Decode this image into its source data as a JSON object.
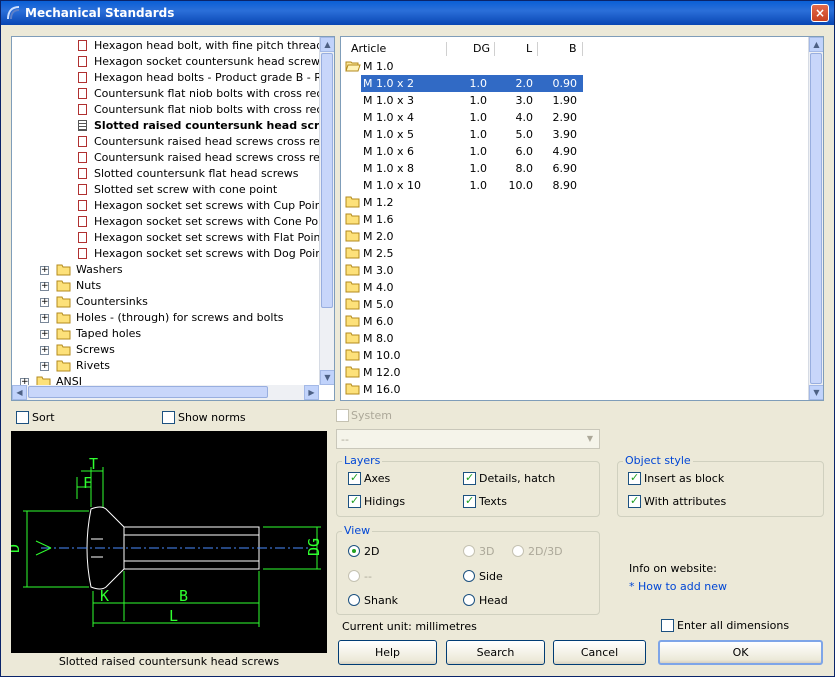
{
  "window": {
    "title": "Mechanical Standards",
    "close_label": "×"
  },
  "tree": {
    "items": [
      "Hexagon head bolt, with fine pitch thread",
      "Hexagon socket countersunk head screws",
      "Hexagon head bolts - Product grade B - Reduc",
      "Countersunk flat niob bolts with cross recess H",
      "Countersunk flat niob bolts with cross recess Z",
      "Slotted raised countersunk head screws",
      "Countersunk raised head screws cross recess-",
      "Countersunk raised head screws cross recess-",
      "Slotted countersunk flat head screws",
      "Slotted set screw with cone point",
      "Hexagon socket set screws with Cup Point",
      "Hexagon socket set screws with Cone Point",
      "Hexagon socket set screws with Flat Point",
      "Hexagon socket set screws with Dog Point"
    ],
    "selected_index": 5,
    "groups": [
      "Washers",
      "Nuts",
      "Countersinks",
      "Holes - (through) for screws and bolts",
      "Taped holes",
      "Screws",
      "Rivets"
    ],
    "root": "ANSI"
  },
  "articles": {
    "columns": {
      "article": "Article",
      "dg": "DG",
      "l": "L",
      "b": "B"
    },
    "open_folder": "M 1.0",
    "rows": [
      {
        "article": "M 1.0 x 2",
        "dg": "1.0",
        "l": "2.0",
        "b": "0.90"
      },
      {
        "article": "M 1.0 x 3",
        "dg": "1.0",
        "l": "3.0",
        "b": "1.90"
      },
      {
        "article": "M 1.0 x 4",
        "dg": "1.0",
        "l": "4.0",
        "b": "2.90"
      },
      {
        "article": "M 1.0 x 5",
        "dg": "1.0",
        "l": "5.0",
        "b": "3.90"
      },
      {
        "article": "M 1.0 x 6",
        "dg": "1.0",
        "l": "6.0",
        "b": "4.90"
      },
      {
        "article": "M 1.0 x 8",
        "dg": "1.0",
        "l": "8.0",
        "b": "6.90"
      },
      {
        "article": "M 1.0 x 10",
        "dg": "1.0",
        "l": "10.0",
        "b": "8.90"
      }
    ],
    "selected_row": 0,
    "folders": [
      "M 1.2",
      "M 1.6",
      "M 2.0",
      "M 2.5",
      "M 3.0",
      "M 4.0",
      "M 5.0",
      "M 6.0",
      "M 8.0",
      "M 10.0",
      "M 12.0",
      "M 16.0"
    ]
  },
  "options": {
    "sort": "Sort",
    "show_norms": "Show norms",
    "system": "System",
    "system_value": "--",
    "layers_title": "Layers",
    "axes": "Axes",
    "details_hatch": "Details, hatch",
    "hidings": "Hidings",
    "texts": "Texts",
    "object_style_title": "Object style",
    "insert_as_block": "Insert as block",
    "with_attributes": "With attributes",
    "view_title": "View",
    "view_2d": "2D",
    "view_3d": "3D",
    "view_2d3d": "2D/3D",
    "view_none": "--",
    "view_side": "Side",
    "view_shank": "Shank",
    "view_head": "Head",
    "info_label": "Info on website:",
    "info_link": "* How to add new",
    "current_unit": "Current unit: millimetres",
    "enter_all_dims": "Enter all dimensions"
  },
  "preview": {
    "caption": "Slotted raised countersunk head screws",
    "dim_labels": {
      "t": "T",
      "f": "F",
      "d": "D",
      "dg": "DG",
      "k": "K",
      "b": "B",
      "l": "L"
    }
  },
  "buttons": {
    "help": "Help",
    "search": "Search",
    "cancel": "Cancel",
    "ok": "OK"
  }
}
